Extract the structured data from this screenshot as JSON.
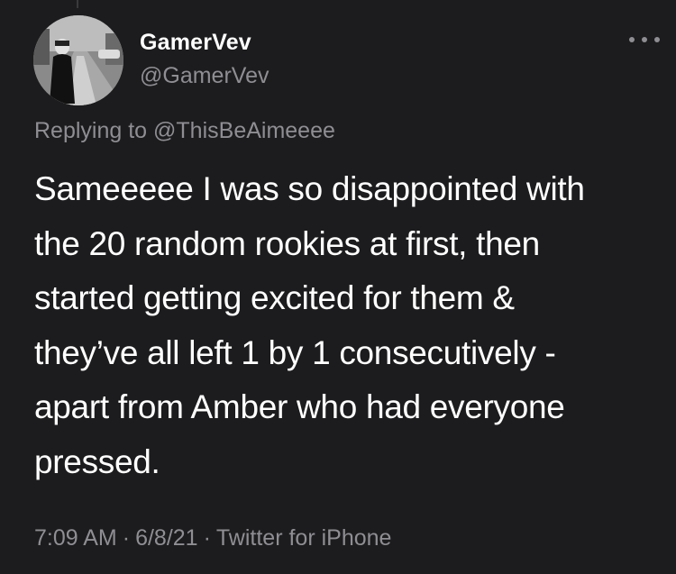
{
  "tweet": {
    "author": {
      "display_name": "GamerVev",
      "handle": "@GamerVev"
    },
    "more_icon": "more-horizontal-icon",
    "reply_to": {
      "prefix": "Replying to",
      "handle": "@ThisBeAimeeee"
    },
    "text_lines": [
      "Sameeeee I was so disappointed with",
      "the 20 random rookies at first, then",
      "started getting excited for them &",
      "they’ve all left 1 by 1 consecutively -",
      "apart from Amber who had everyone",
      "pressed."
    ],
    "time": "7:09 AM",
    "separator": "·",
    "date": "6/8/21",
    "source": "Twitter for iPhone"
  },
  "colors": {
    "background": "#1c1c1e",
    "primary_text": "#ffffff",
    "secondary_text": "#8e8e93"
  }
}
